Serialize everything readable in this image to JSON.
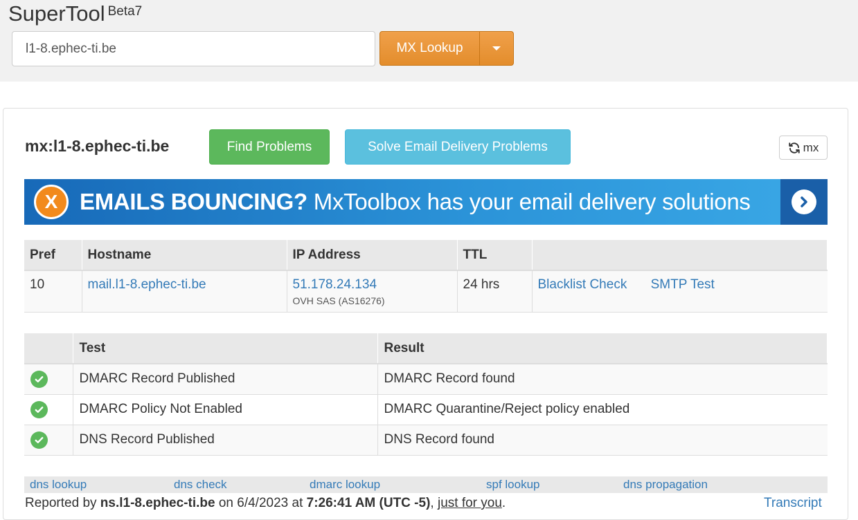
{
  "header": {
    "brand": "SuperTool",
    "beta": "Beta7",
    "search_value": "l1-8.ephec-ti.be",
    "lookup_label": "MX Lookup"
  },
  "panel": {
    "title": "mx:l1-8.ephec-ti.be",
    "find_problems_label": "Find Problems",
    "solve_label": "Solve Email Delivery Problems",
    "refresh_label": "mx",
    "banner": {
      "bold_text": "EMAILS BOUNCING?",
      "text": " MxToolbox has your email delivery solutions",
      "x_glyph": "X"
    }
  },
  "mx_table": {
    "headers": [
      "Pref",
      "Hostname",
      "IP Address",
      "TTL",
      ""
    ],
    "row": {
      "pref": "10",
      "hostname": "mail.l1-8.ephec-ti.be",
      "ip": "51.178.24.134",
      "asn": "OVH SAS (AS16276)",
      "ttl": "24 hrs",
      "blacklist": "Blacklist Check",
      "smtp": "SMTP Test"
    }
  },
  "test_table": {
    "headers": [
      "",
      "Test",
      "Result"
    ],
    "rows": [
      {
        "test": "DMARC Record Published",
        "result": "DMARC Record found",
        "status": "ok"
      },
      {
        "test": "DMARC Policy Not Enabled",
        "result": "DMARC Quarantine/Reject policy enabled",
        "status": "ok"
      },
      {
        "test": "DNS Record Published",
        "result": "DNS Record found",
        "status": "ok"
      }
    ]
  },
  "footer": {
    "links": [
      "dns lookup",
      "dns check",
      "dmarc lookup",
      "spf lookup",
      "dns propagation"
    ],
    "reported_prefix": "Reported by ",
    "reported_host": "ns.l1-8.ephec-ti.be",
    "reported_on": " on 6/4/2023 at ",
    "reported_time": "7:26:41 AM (UTC -5)",
    "reported_sep": ", ",
    "just_for_you": "just for you",
    "period": ".",
    "transcript": "Transcript"
  },
  "colors": {
    "accent_orange": "#e38d2c",
    "success_green": "#5cb85c",
    "info_blue": "#5bc0de",
    "link_blue": "#337ab7"
  },
  "icons": [
    "caret-down-icon",
    "refresh-icon",
    "x-circle-icon",
    "chevron-right-icon",
    "check-circle-icon"
  ]
}
